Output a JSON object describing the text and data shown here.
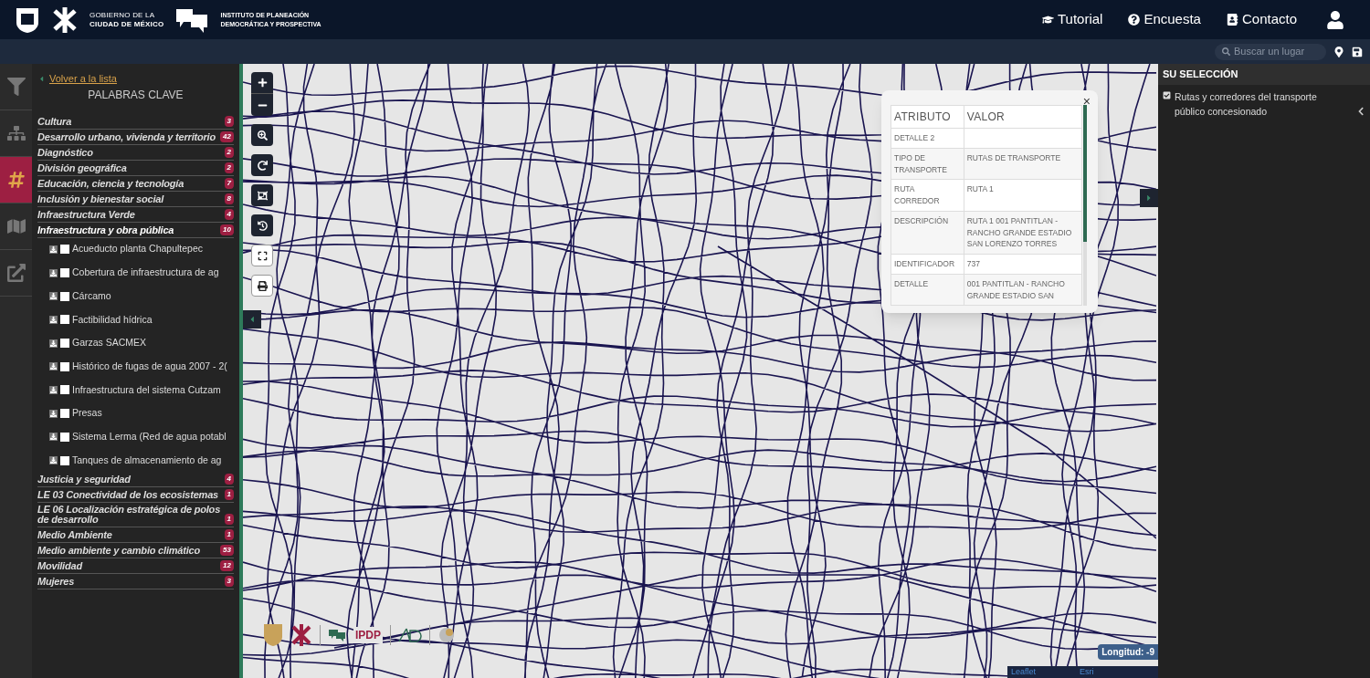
{
  "header": {
    "gov_logo": [
      "GOBIERNO DE LA",
      "CIUDAD DE MÉXICO"
    ],
    "institute_logo": [
      "INSTITUTO DE PLANEACIÓN",
      "DEMOCRÁTICA Y PROSPECTIVA"
    ],
    "nav": [
      {
        "label": "Tutorial",
        "kind": "tutorial"
      },
      {
        "label": "Encuesta",
        "kind": "survey"
      },
      {
        "label": "Contacto",
        "kind": "contact"
      }
    ]
  },
  "search": {
    "placeholder": "Buscar un lugar"
  },
  "rail": [
    {
      "kind": "filter",
      "selected": false
    },
    {
      "kind": "tree",
      "selected": false
    },
    {
      "kind": "hash",
      "selected": true
    },
    {
      "kind": "map",
      "selected": false
    },
    {
      "kind": "export",
      "selected": false
    }
  ],
  "sidebar": {
    "back_link": "Volver a la lista",
    "title": "PALABRAS CLAVE",
    "categories": [
      {
        "name": "Cultura",
        "count": "3",
        "expanded": false
      },
      {
        "name": "Desarrollo urbano, vivienda y territorio",
        "count": "42",
        "expanded": false
      },
      {
        "name": "Diagnóstico",
        "count": "2",
        "expanded": false
      },
      {
        "name": "División geográfica",
        "count": "2",
        "expanded": false
      },
      {
        "name": "Educación, ciencia y tecnología",
        "count": "7",
        "expanded": false
      },
      {
        "name": "Inclusión y bienestar social",
        "count": "8",
        "expanded": false
      },
      {
        "name": "Infraestructura Verde",
        "count": "4",
        "expanded": false
      },
      {
        "name": "Infraestructura y obra pública",
        "count": "10",
        "expanded": true,
        "children": [
          {
            "name": "Acueducto planta Chapultepec",
            "checked": false
          },
          {
            "name": "Cobertura de infraestructura de ag",
            "checked": false
          },
          {
            "name": "Cárcamo",
            "checked": false
          },
          {
            "name": "Factibilidad hídrica",
            "checked": false
          },
          {
            "name": "Garzas SACMEX",
            "checked": false
          },
          {
            "name": "Histórico de fugas de agua 2007 - 2(",
            "checked": false
          },
          {
            "name": "Infraestructura del sistema Cutzam",
            "checked": false
          },
          {
            "name": "Presas",
            "checked": false
          },
          {
            "name": "Sistema Lerma (Red de agua potabl",
            "checked": false
          },
          {
            "name": "Tanques de almacenamiento de ag",
            "checked": false
          }
        ]
      },
      {
        "name": "Justicia y seguridad",
        "count": "4",
        "expanded": false
      },
      {
        "name": "LE 03 Conectividad de los ecosistemas",
        "count": "1",
        "expanded": false
      },
      {
        "name": "LE 06 Localización estratégica de polos de desarrollo",
        "count": "1",
        "expanded": false
      },
      {
        "name": "Medio Ambiente",
        "count": "1",
        "expanded": false
      },
      {
        "name": "Medio ambiente y cambio climático",
        "count": "53",
        "expanded": false
      },
      {
        "name": "Movilidad",
        "count": "12",
        "expanded": false
      },
      {
        "name": "Mujeres",
        "count": "3",
        "expanded": false
      }
    ]
  },
  "popup": {
    "columns": [
      "ATRIBUTO",
      "VALOR"
    ],
    "rows": [
      [
        "DETALLE 2",
        ""
      ],
      [
        "TIPO DE TRANSPORTE",
        "RUTAS DE TRANSPORTE"
      ],
      [
        "RUTA CORREDOR",
        "RUTA 1"
      ],
      [
        "DESCRIPCIÓN",
        "RUTA 1 001 PANTITLAN - RANCHO GRANDE ESTADIO SAN LORENZO TORRES"
      ],
      [
        "IDENTIFICADOR",
        "737"
      ],
      [
        "DETALLE",
        "001 PANTITLAN - RANCHO GRANDE ESTADIO SAN"
      ]
    ],
    "close": "×"
  },
  "map": {
    "partner_logo": "IPDP",
    "coordinates": "Longitud: -9",
    "attribution": [
      "Leaflet",
      "Esri"
    ]
  },
  "selection": {
    "title": "SU SELECCIÓN",
    "items": [
      {
        "label": "Rutas y corredores del transporte público concesionado",
        "checked": true
      }
    ]
  }
}
